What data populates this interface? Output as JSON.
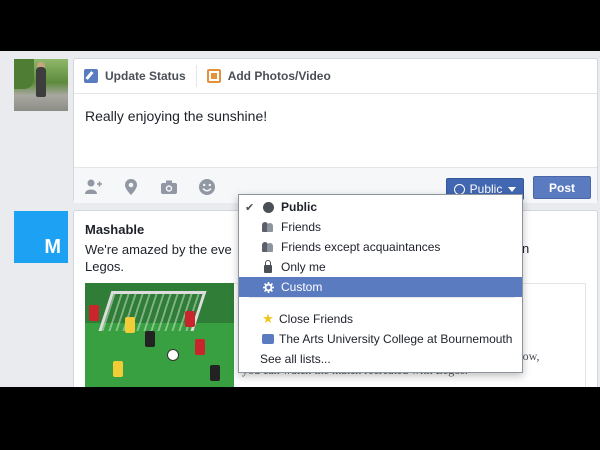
{
  "composer": {
    "tabs": [
      {
        "label": "Update Status",
        "icon": "pencil-icon"
      },
      {
        "label": "Add Photos/Video",
        "icon": "photo-icon"
      }
    ],
    "status_text": "Really enjoying the sunshine!",
    "privacy_label": "Public",
    "post_label": "Post"
  },
  "story": {
    "page_name": "Mashable",
    "avatar_letter": "M",
    "text_line1": "We're amazed by the eve",
    "text_line1_end": "n",
    "text_line2": "Legos.",
    "link_end1": "ns",
    "link_end2": "Now,",
    "link_text": "you can watch the match recreated with Legos."
  },
  "privacy_menu": {
    "items": [
      {
        "label": "Public",
        "icon": "globe-icon",
        "checked": true
      },
      {
        "label": "Friends",
        "icon": "friends-icon"
      },
      {
        "label": "Friends except acquaintances",
        "icon": "friends-except-icon"
      },
      {
        "label": "Only me",
        "icon": "lock-icon"
      },
      {
        "label": "Custom",
        "icon": "gear-icon",
        "selected": true
      }
    ],
    "lists": [
      {
        "label": "Close Friends",
        "icon": "star-icon"
      },
      {
        "label": "The Arts University College at Bournemouth",
        "icon": "school-icon"
      },
      {
        "label": "See all lists..."
      }
    ],
    "check_mark": "✔"
  },
  "colors": {
    "facebook_blue": "#4267b2",
    "selected_bg": "#5b7bc0",
    "page_avatar": "#1da1f2"
  }
}
